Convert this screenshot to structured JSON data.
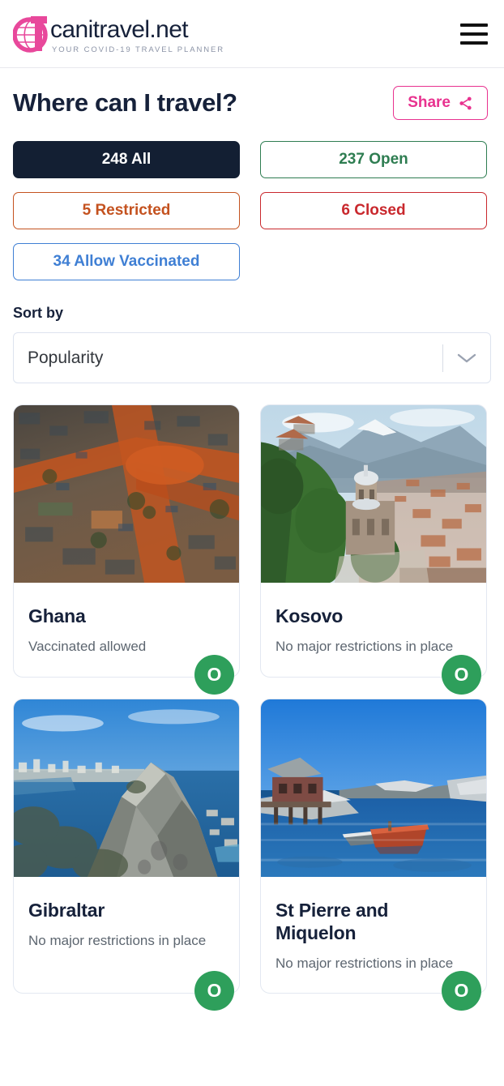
{
  "header": {
    "logo_word": "canitravel.net",
    "logo_tagline": "YOUR COVID-19 TRAVEL PLANNER",
    "menu_icon": "hamburger-menu-icon"
  },
  "title": "Where can I travel?",
  "share": {
    "label": "Share",
    "icon": "share-icon"
  },
  "filters": [
    {
      "key": "all",
      "label": "248 All",
      "count": 248,
      "color": "#ffffff",
      "bg": "#131f33",
      "active": true
    },
    {
      "key": "open",
      "label": "237 Open",
      "count": 237,
      "color": "#2e7d51",
      "bg": "#ffffff",
      "active": false
    },
    {
      "key": "restricted",
      "label": "5 Restricted",
      "count": 5,
      "color": "#c4521f",
      "bg": "#ffffff",
      "active": false
    },
    {
      "key": "closed",
      "label": "6 Closed",
      "count": 6,
      "color": "#c9282d",
      "bg": "#ffffff",
      "active": false
    },
    {
      "key": "vaccinated",
      "label": "34 Allow Vaccinated",
      "count": 34,
      "color": "#3f7fd4",
      "bg": "#ffffff",
      "active": false
    }
  ],
  "sort": {
    "label": "Sort by",
    "value": "Popularity",
    "caret_icon": "chevron-down-icon"
  },
  "cards": [
    {
      "name": "Ghana",
      "status": "Vaccinated allowed",
      "badge": "O",
      "badge_color": "#2e9f5b",
      "image": "aerial-view-of-dense-city-with-orange-dirt-roads"
    },
    {
      "name": "Kosovo",
      "status": "No major restrictions in place",
      "badge": "O",
      "badge_color": "#2e9f5b",
      "image": "stone-church-on-green-hillside-above-town-with-mountains"
    },
    {
      "name": "Gibraltar",
      "status": "No major restrictions in place",
      "badge": "O",
      "badge_color": "#2e9f5b",
      "image": "rock-of-gibraltar-ridge-over-blue-sea-and-bay"
    },
    {
      "name": "St Pierre and Miquelon",
      "status": "No major restrictions in place",
      "badge": "O",
      "badge_color": "#2e9f5b",
      "image": "red-wooden-boat-in-calm-cove-with-rocky-shore"
    }
  ]
}
